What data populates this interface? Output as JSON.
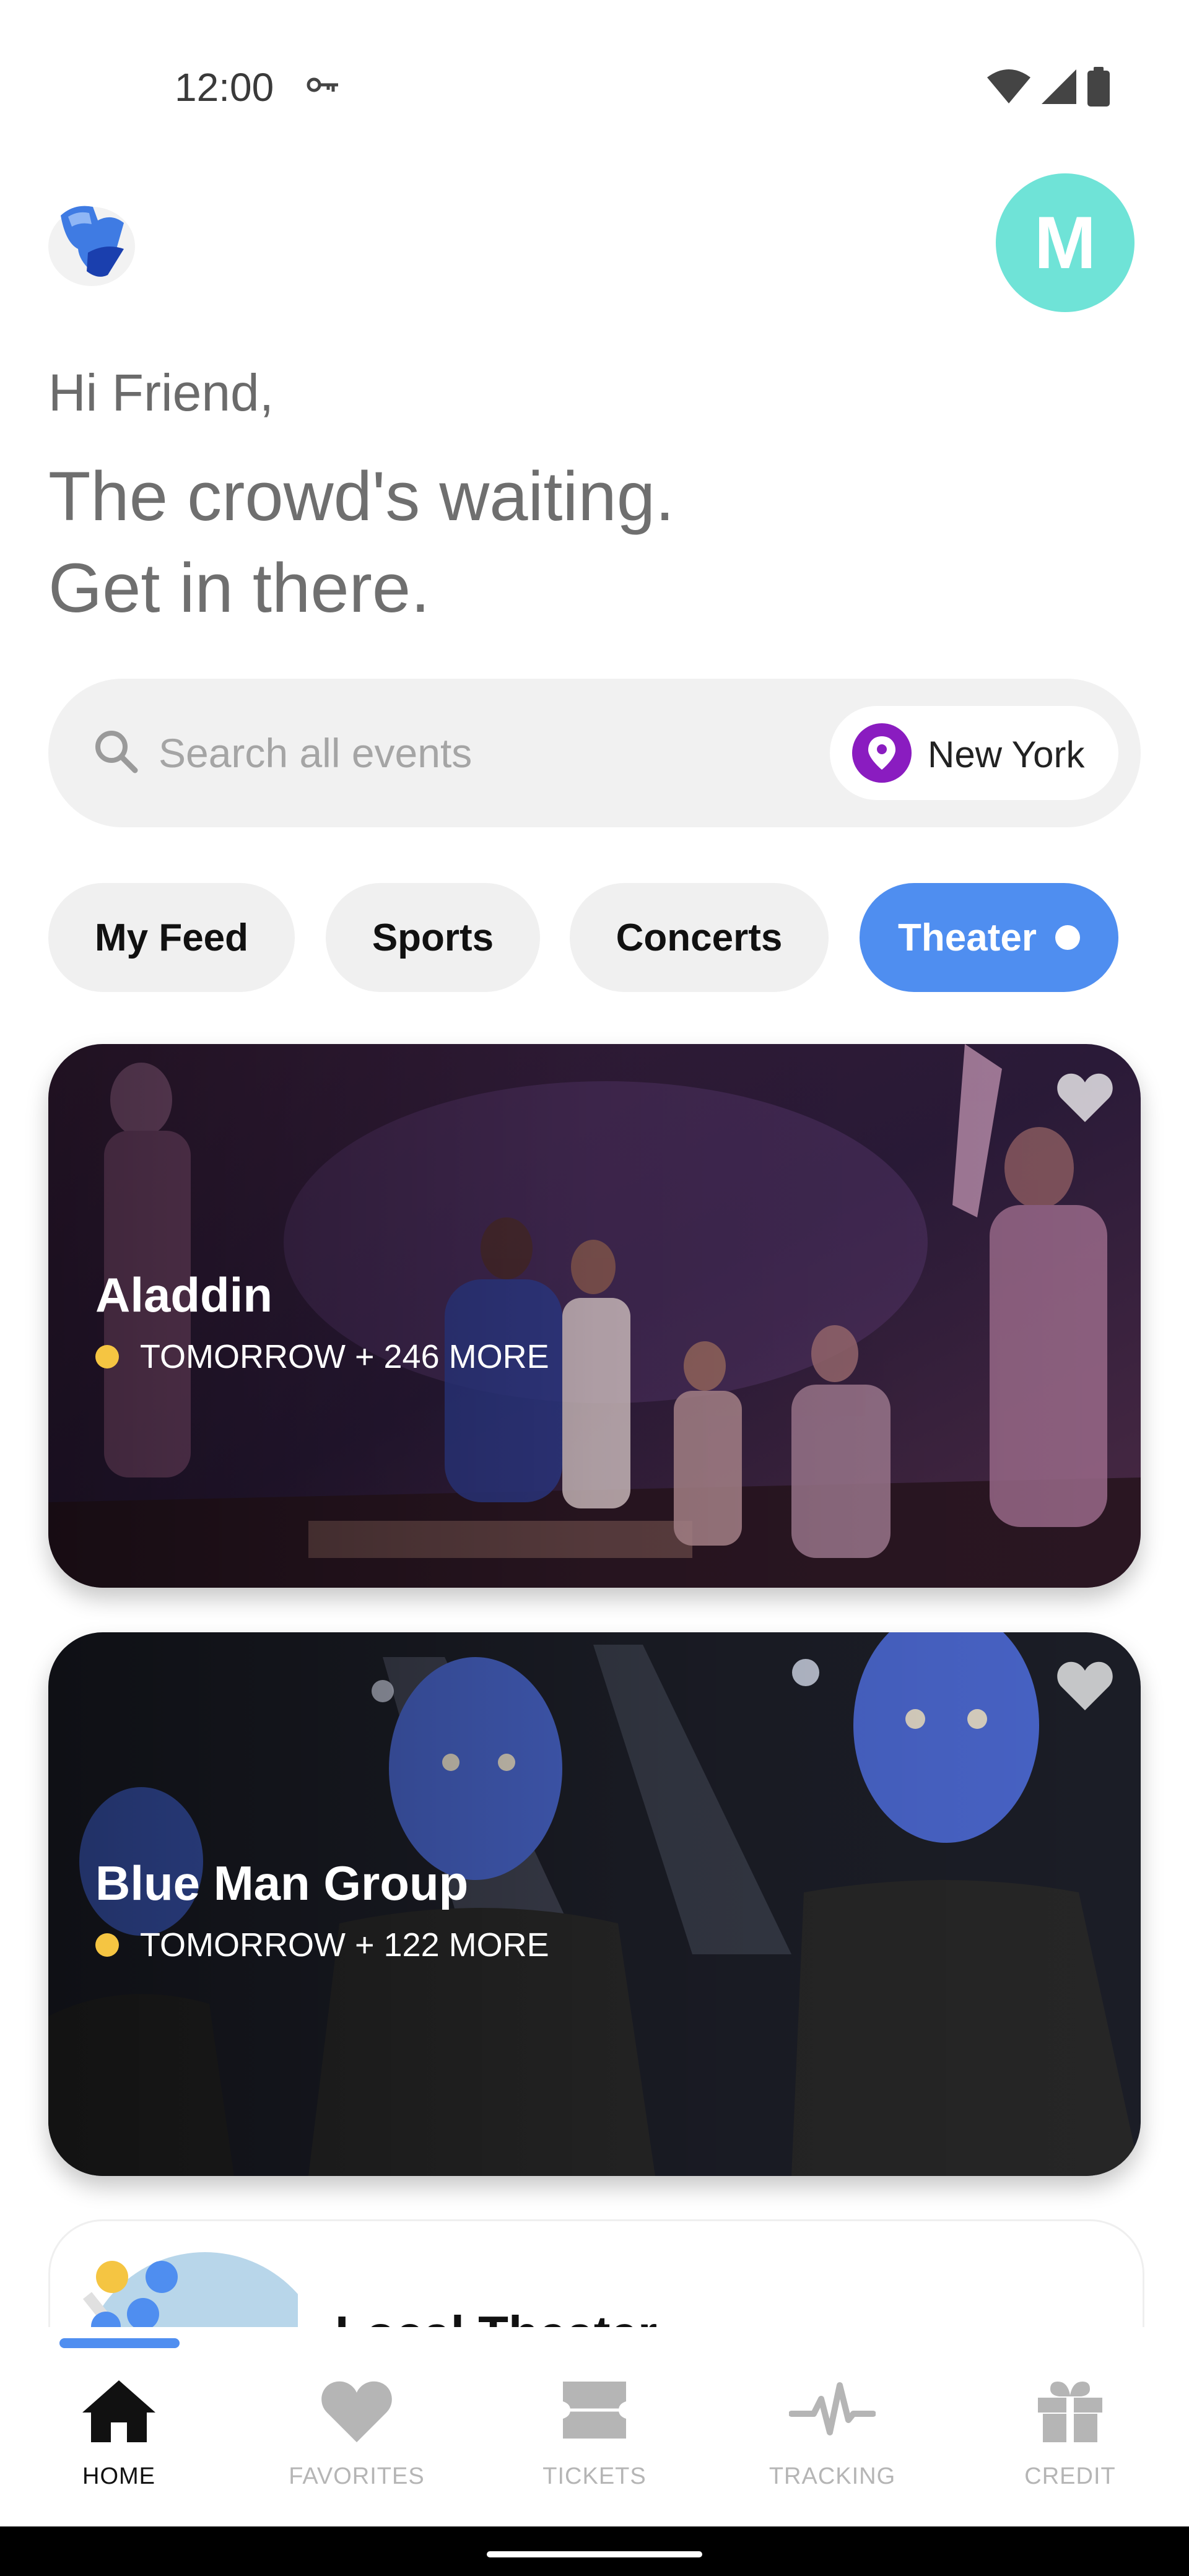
{
  "status_bar": {
    "time": "12:00"
  },
  "header": {
    "avatar_initial": "M"
  },
  "greeting": {
    "hello": "Hi Friend,",
    "headline_line1": "The crowd's waiting.",
    "headline_line2": "Get in there."
  },
  "search": {
    "placeholder": "Search all events",
    "location": "New York"
  },
  "tabs": [
    {
      "label": "My Feed",
      "active": false
    },
    {
      "label": "Sports",
      "active": false
    },
    {
      "label": "Concerts",
      "active": false
    },
    {
      "label": "Theater",
      "active": true
    }
  ],
  "events": [
    {
      "title": "Aladdin",
      "subtitle": "TOMORROW + 246 MORE"
    },
    {
      "title": "Blue Man Group",
      "subtitle": "TOMORROW + 122 MORE"
    }
  ],
  "local_card": {
    "title": "Local Theater"
  },
  "bottom_nav": [
    {
      "label": "HOME",
      "icon": "home-icon",
      "active": true
    },
    {
      "label": "FAVORITES",
      "icon": "heart-icon",
      "active": false
    },
    {
      "label": "TICKETS",
      "icon": "ticket-icon",
      "active": false
    },
    {
      "label": "TRACKING",
      "icon": "pulse-icon",
      "active": false
    },
    {
      "label": "CREDIT",
      "icon": "gift-icon",
      "active": false
    }
  ],
  "colors": {
    "accent": "#4f8ef0",
    "avatar": "#6fe3d7",
    "location_pin": "#8a1cc0",
    "event_dot": "#f5c542",
    "nav_active": "#111111",
    "nav_inactive": "#b5b5b5"
  }
}
